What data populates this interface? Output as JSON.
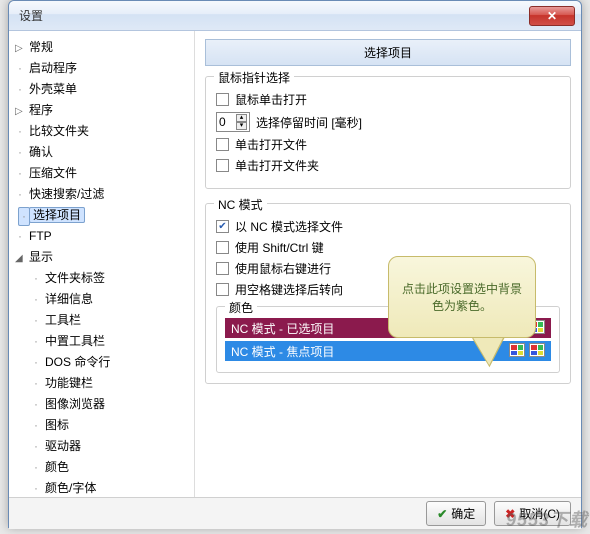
{
  "window": {
    "title": "设置"
  },
  "tree": {
    "items": [
      {
        "label": "常规",
        "caret": true
      },
      {
        "label": "启动程序"
      },
      {
        "label": "外壳菜单"
      },
      {
        "label": "程序",
        "caret": true
      },
      {
        "label": "比较文件夹"
      },
      {
        "label": "确认"
      },
      {
        "label": "压缩文件"
      },
      {
        "label": "快速搜索/过滤"
      },
      {
        "label": "选择项目",
        "selected": true
      },
      {
        "label": "FTP"
      },
      {
        "label": "显示",
        "caret": true,
        "expanded": true
      },
      {
        "label": "文件夹标签",
        "level": 2
      },
      {
        "label": "详细信息",
        "level": 2
      },
      {
        "label": "工具栏",
        "level": 2
      },
      {
        "label": "中置工具栏",
        "level": 2
      },
      {
        "label": "DOS 命令行",
        "level": 2
      },
      {
        "label": "功能键栏",
        "level": 2
      },
      {
        "label": "图像浏览器",
        "level": 2
      },
      {
        "label": "图标",
        "level": 2
      },
      {
        "label": "驱动器",
        "level": 2
      },
      {
        "label": "颜色",
        "level": 2
      },
      {
        "label": "颜色/字体",
        "level": 2
      }
    ]
  },
  "content": {
    "header": "选择项目",
    "group1": {
      "title": "鼠标指针选择",
      "cb_click_open": "鼠标单击打开",
      "hover_value": "0",
      "hover_label": "选择停留时间 [毫秒]",
      "cb_open_file": "单击打开文件",
      "cb_open_folder": "单击打开文件夹"
    },
    "group2": {
      "title": "NC 模式",
      "cb_nc_select": "以 NC 模式选择文件",
      "cb_shift_ctrl": "使用 Shift/Ctrl 键",
      "cb_right_click": "使用鼠标右键进行",
      "cb_space": "用空格键选择后转向",
      "colors_title": "颜色",
      "bar_selected": "NC 模式 - 已选项目",
      "bar_focused": "NC 模式 - 焦点项目"
    },
    "callout": "点击此项设置选中背景色为紫色。"
  },
  "footer": {
    "ok": "确定",
    "cancel": "取消(C)"
  },
  "watermark": "9553下载"
}
